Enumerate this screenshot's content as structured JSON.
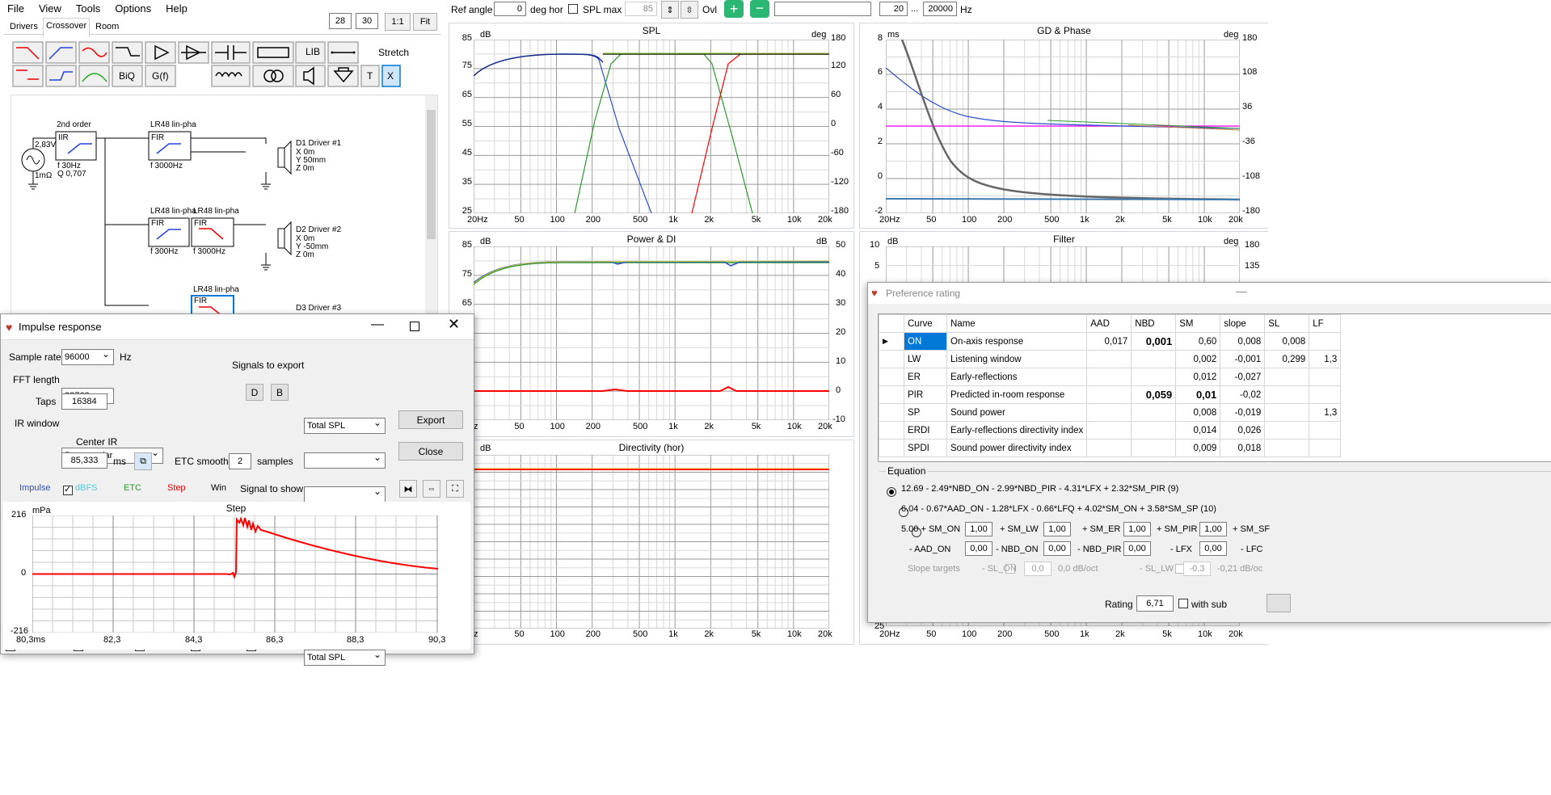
{
  "menu": [
    "File",
    "View",
    "Tools",
    "Options",
    "Help"
  ],
  "tabs": [
    "Drivers",
    "Crossover",
    "Room"
  ],
  "zoom_buttons": [
    "28",
    "30",
    "1:1",
    "Fit"
  ],
  "toolbar": {
    "ref_angle_label": "Ref angle",
    "ref_angle": "0",
    "deg_hor": "deg hor",
    "spl_max_label": "SPL max",
    "spl_max": "85",
    "ovl": "Ovl",
    "freq_from": "20",
    "dots": "...",
    "freq_to": "20000",
    "hz": "Hz"
  },
  "crossover_tools": {
    "lib": "LIB",
    "stretch": "Stretch",
    "biq": "BiQ",
    "gf": "G(f)",
    "t": "T",
    "x": "X"
  },
  "schematic": {
    "source": {
      "v": "2,83V",
      "r": "1mΩ"
    },
    "filter1": {
      "title": "2nd order",
      "type": "IIR",
      "f": "f  30Hz",
      "q": "Q 0,707"
    },
    "filter2": {
      "title": "LR48 lin-pha",
      "type": "FIR",
      "f": "f  3000Hz"
    },
    "filter3": {
      "title": "LR48 lin-pha",
      "type": "FIR",
      "f": "f  300Hz"
    },
    "filter4": {
      "title": "LR48 lin-pha",
      "type": "FIR",
      "f": "f  3000Hz"
    },
    "filter5": {
      "title": "LR48 lin-pha",
      "type": "FIR"
    },
    "driver1": {
      "name": "D1 Driver #1",
      "x": "X 0m",
      "y": "Y 50mm",
      "z": "Z 0m"
    },
    "driver2": {
      "name": "D2 Driver #2",
      "x": "X 0m",
      "y": "Y -50mm",
      "z": "Z 0m"
    },
    "driver3": {
      "name": "D3 Driver #3"
    }
  },
  "plots": {
    "spl": {
      "title": "SPL",
      "yunit": "dB",
      "y2unit": "deg",
      "yticks": [
        "85",
        "75",
        "65",
        "55",
        "45",
        "35",
        "25"
      ],
      "y2ticks": [
        "180",
        "120",
        "60",
        "0",
        "-60",
        "-120",
        "-180"
      ]
    },
    "gd": {
      "title": "GD & Phase",
      "yunit": "ms",
      "y2unit": "deg",
      "yticks": [
        "8",
        "6",
        "4",
        "2",
        "0",
        "-2"
      ],
      "y2ticks": [
        "180",
        "108",
        "36",
        "-36",
        "-108",
        "-180"
      ]
    },
    "power": {
      "title": "Power & DI",
      "yunit": "dB",
      "y2unit": "dB",
      "yticks": [
        "85",
        "75",
        "65"
      ],
      "y2ticks": [
        "50",
        "40",
        "30",
        "20",
        "10",
        "0",
        "-10"
      ]
    },
    "filter": {
      "title": "Filter",
      "yunit": "dB",
      "y2unit": "deg",
      "yticks": [
        "10",
        "5"
      ],
      "y2ticks": [
        "180",
        "135"
      ]
    },
    "directivity": {
      "title": "Directivity (hor)",
      "yunit": "dB"
    },
    "xticks": [
      "20Hz",
      "50",
      "100",
      "200",
      "500",
      "1k",
      "2k",
      "5k",
      "10k",
      "20k"
    ],
    "xticks_short": [
      "Hz",
      "50",
      "100",
      "200",
      "500",
      "1k",
      "2k",
      "5k",
      "10k",
      "20k"
    ],
    "bottom_left_y": "25"
  },
  "impulse": {
    "title": "Impulse response",
    "sample_rate_label": "Sample rate",
    "sample_rate": "96000",
    "hz": "Hz",
    "fft_label": "FFT length",
    "fft": "32768",
    "taps_label": "Taps",
    "taps": "16384",
    "irwin_label": "IR window",
    "irwin": "Rectangular",
    "center_ir": "Center IR",
    "center_val": "85,333",
    "ms": "ms",
    "etc_smooth_label": "ETC smooth",
    "etc_smooth": "2",
    "samples": "samples",
    "signals_export": "Signals to export",
    "export_sel": "Total SPL",
    "d": "D",
    "b": "B",
    "export_btn": "Export",
    "close_btn": "Close",
    "checks": [
      "Impulse",
      "dBFS",
      "ETC",
      "Step",
      "Win"
    ],
    "signal_show_label": "Signal to show",
    "signal_show": "Total SPL",
    "plot_title": "Step",
    "yunit": "mPa",
    "yticks": [
      "216",
      "0",
      "-216"
    ],
    "xticks": [
      "80,3ms",
      "82,3",
      "84,3",
      "86,3",
      "88,3",
      "90,3"
    ]
  },
  "pref": {
    "title": "Preference rating",
    "headers": [
      "Curve",
      "Name",
      "AAD",
      "NBD",
      "SM",
      "slope",
      "SL",
      "LF"
    ],
    "rows": [
      [
        "ON",
        "On-axis response",
        "0,017",
        "0,001",
        "0,60",
        "0,008",
        "0,008",
        ""
      ],
      [
        "LW",
        "Listening window",
        "",
        "",
        "0,002",
        "-0,001",
        "0,299",
        "1,3"
      ],
      [
        "ER",
        "Early-reflections",
        "",
        "",
        "0,012",
        "-0,027",
        "",
        ""
      ],
      [
        "PIR",
        "Predicted in-room response",
        "",
        "0,059",
        "0,01",
        "-0,02",
        "",
        ""
      ],
      [
        "SP",
        "Sound power",
        "",
        "",
        "0,008",
        "-0,019",
        "",
        "1,3"
      ],
      [
        "ERDI",
        "Early-reflections directivity index",
        "",
        "",
        "0,014",
        "0,026",
        "",
        ""
      ],
      [
        "SPDI",
        "Sound power directivity index",
        "",
        "",
        "0,009",
        "0,018",
        "",
        ""
      ]
    ],
    "equation_label": "Equation",
    "eq1": "12.69 - 2.49*NBD_ON - 2.99*NBD_PIR - 4.31*LFX + 2.32*SM_PIR (9)",
    "eq2": "6.04 - 0.67*AAD_ON - 1.28*LFX - 0.66*LFQ + 4.02*SM_ON + 3.58*SM_SP (10)",
    "eq3a": "5.00 + SM_ON",
    "eq3_v1": "1,00",
    "eq3b": "+ SM_LW",
    "eq3_v2": "1,00",
    "eq3c": "+ SM_ER",
    "eq3_v3": "1,00",
    "eq3d": "+ SM_PIR",
    "eq3_v4": "1,00",
    "eq3e": "+ SM_SF",
    "eq4a": "- AAD_ON",
    "eq4_v1": "0,00",
    "eq4b": "- NBD_ON",
    "eq4_v2": "0,00",
    "eq4c": "- NBD_PIR",
    "eq4_v3": "0,00",
    "eq4d": "- LFX",
    "eq4_v4": "0,00",
    "eq4e": "- LFC",
    "slope_targets": "Slope targets",
    "sl_on": "- SL_ON",
    "sl_on_v": "0,0",
    "sl_on_u": "0,0 dB/oct",
    "sl_lw": "- SL_LW",
    "sl_lw_v": "-0,3",
    "sl_lw_u": "-0,21 dB/oc",
    "rating_label": "Rating",
    "rating": "6,71",
    "with_sub": "with sub"
  },
  "colors": {
    "accent": "#0078d7",
    "red": "#ff0000",
    "blue": "#2a4fd0",
    "green": "#2a9a2a"
  }
}
